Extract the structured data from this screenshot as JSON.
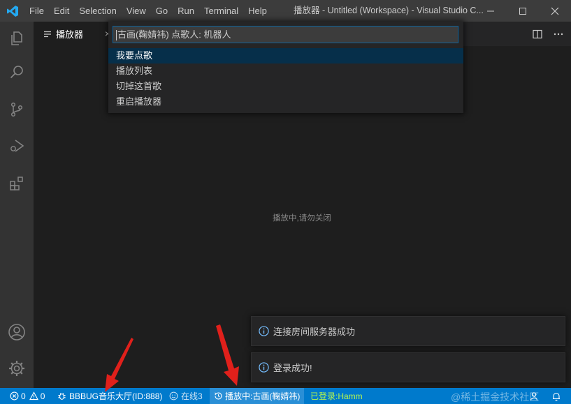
{
  "titlebar": {
    "menu": [
      "File",
      "Edit",
      "Selection",
      "View",
      "Go",
      "Run",
      "Terminal",
      "Help"
    ],
    "title": "播放器 - Untitled (Workspace) - Visual Studio C..."
  },
  "tab": {
    "label": "播放器",
    "close": "×"
  },
  "quickpick": {
    "placeholder": "古画(鞠婧祎) 点歌人: 机器人",
    "items": [
      "我要点歌",
      "播放列表",
      "切掉这首歌",
      "重启播放器"
    ]
  },
  "editor": {
    "message": "播放中,请勿关闭"
  },
  "notifications": [
    {
      "text": "连接房间服务器成功"
    },
    {
      "text": "登录成功!"
    }
  ],
  "statusbar": {
    "errors": "0",
    "warnings": "0",
    "room": "BBBUG音乐大厅(ID:888)",
    "online": "在线3",
    "playing": "播放中:古画(鞠婧祎)",
    "login": "已登录:Hamm"
  },
  "watermark": "@稀土掘金技术社区",
  "colors": {
    "statusbar": "#007acc",
    "activitybar": "#333333",
    "editor": "#1e1e1e",
    "login_text": "#b5f54e",
    "arrow": "#e0201b"
  }
}
